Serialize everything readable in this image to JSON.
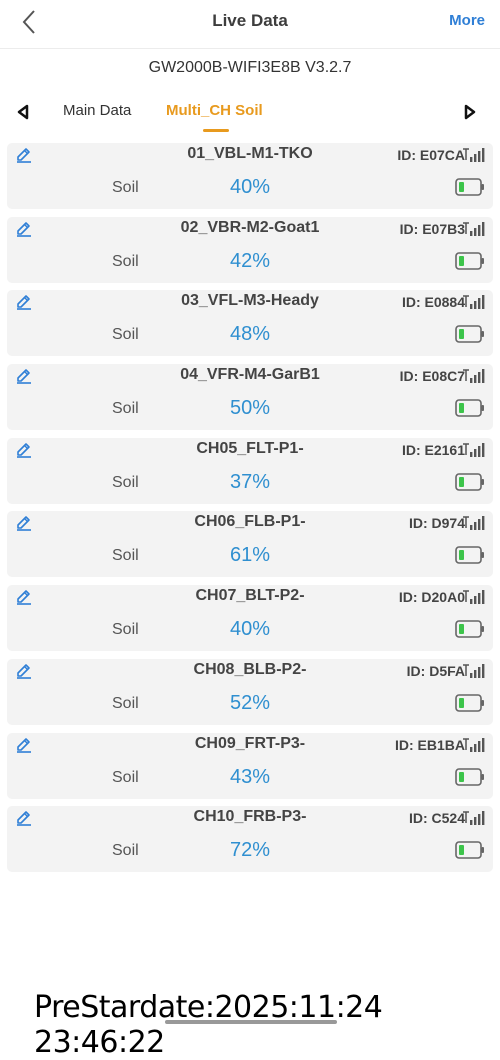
{
  "header": {
    "title": "Live Data",
    "more_label": "More"
  },
  "device": {
    "name": "GW2000B-WIFI3E8B V3.2.7"
  },
  "tabs": [
    {
      "label": "Main Data",
      "active": false
    },
    {
      "label": "Multi_CH Soil",
      "active": true
    }
  ],
  "channels": [
    {
      "name": "01_VBL-M1-TKO",
      "id": "ID: E07CA",
      "label": "Soil",
      "value": "40%"
    },
    {
      "name": "02_VBR-M2-Goat1",
      "id": "ID: E07B3",
      "label": "Soil",
      "value": "42%"
    },
    {
      "name": "03_VFL-M3-Heady",
      "id": "ID: E0884",
      "label": "Soil",
      "value": "48%"
    },
    {
      "name": "04_VFR-M4-GarB1",
      "id": "ID: E08C7",
      "label": "Soil",
      "value": "50%"
    },
    {
      "name": "CH05_FLT-P1-",
      "id": "ID: E2161",
      "label": "Soil",
      "value": "37%"
    },
    {
      "name": "CH06_FLB-P1-",
      "id": "ID: D974",
      "label": "Soil",
      "value": "61%"
    },
    {
      "name": "CH07_BLT-P2-",
      "id": "ID: D20A0",
      "label": "Soil",
      "value": "40%"
    },
    {
      "name": "CH08_BLB-P2-",
      "id": "ID: D5FA",
      "label": "Soil",
      "value": "52%"
    },
    {
      "name": "CH09_FRT-P3-",
      "id": "ID: EB1BA",
      "label": "Soil",
      "value": "43%"
    },
    {
      "name": "CH10_FRB-P3-",
      "id": "ID: C524",
      "label": "Soil",
      "value": "72%"
    }
  ],
  "footer": {
    "stardate": "PreStardate:2025:11:24 23:46:22"
  },
  "colors": {
    "accent": "#e89a1e",
    "value_blue": "#2f8fd0",
    "link_blue": "#2f7fd6",
    "battery_green": "#3cc44a",
    "card_bg": "#f3f3f3"
  }
}
